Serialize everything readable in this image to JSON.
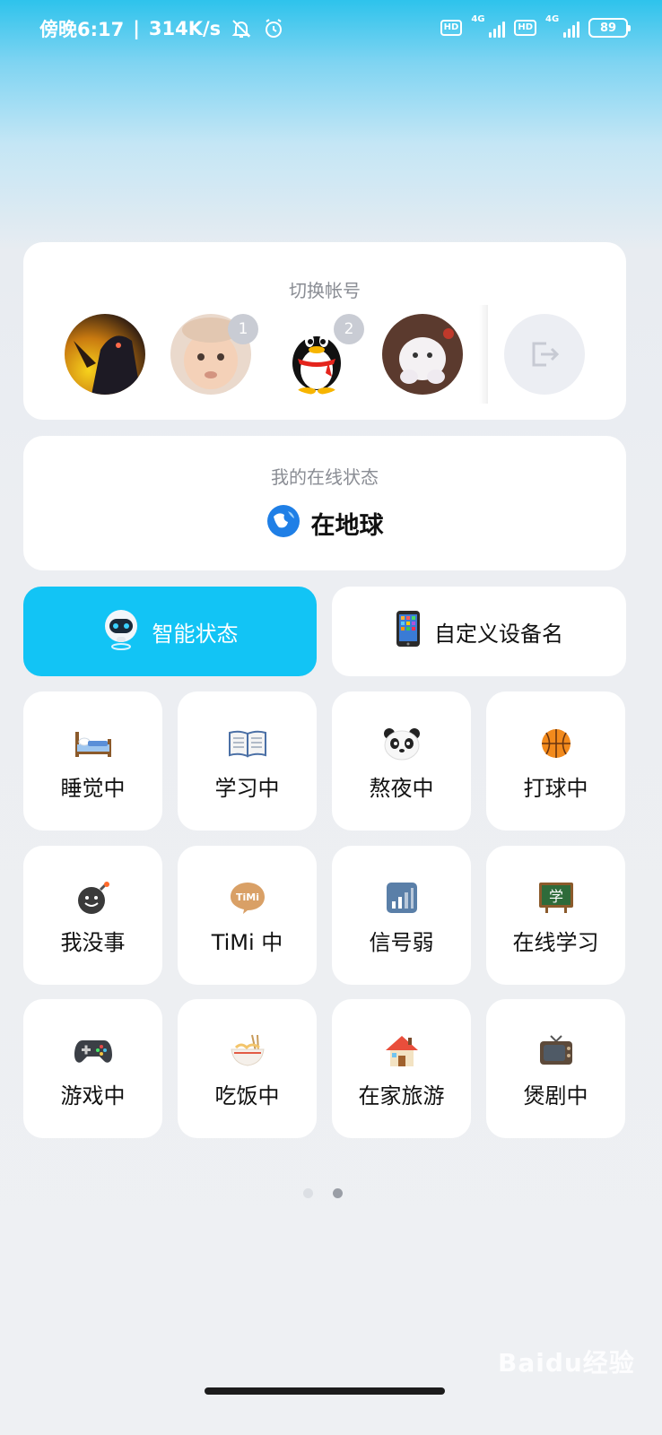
{
  "status_bar": {
    "time": "傍晚6:17",
    "network_speed": "314K/s",
    "icons": [
      "mute-bell-icon",
      "alarm-icon",
      "hd-icon",
      "signal-4g-icon",
      "hd-icon",
      "signal-4g-icon"
    ],
    "hd_label": "HD",
    "network_type": "4G",
    "battery": "89"
  },
  "accounts": {
    "title": "切换帐号",
    "items": [
      {
        "name": "avatar-dark-character",
        "badge": ""
      },
      {
        "name": "avatar-baby",
        "badge": "1"
      },
      {
        "name": "avatar-qq-penguin",
        "badge": "2"
      },
      {
        "name": "avatar-white-fluffy",
        "badge": ""
      }
    ],
    "logout_icon": "logout-icon"
  },
  "online_status": {
    "title": "我的在线状态",
    "value": "在地球",
    "icon": "earth-icon"
  },
  "actions": {
    "smart_label": "智能状态",
    "smart_icon": "robot-icon",
    "device_label": "自定义设备名",
    "device_icon": "phone-icon"
  },
  "statuses": [
    {
      "label": "睡觉中",
      "icon": "bed-icon"
    },
    {
      "label": "学习中",
      "icon": "book-icon"
    },
    {
      "label": "熬夜中",
      "icon": "panda-icon"
    },
    {
      "label": "打球中",
      "icon": "basketball-icon"
    },
    {
      "label": "我没事",
      "icon": "bomb-smile-icon"
    },
    {
      "label": "TiMi 中",
      "icon": "timi-icon"
    },
    {
      "label": "信号弱",
      "icon": "signal-weak-icon"
    },
    {
      "label": "在线学习",
      "icon": "blackboard-icon"
    },
    {
      "label": "游戏中",
      "icon": "gamepad-icon"
    },
    {
      "label": "吃饭中",
      "icon": "noodles-icon"
    },
    {
      "label": "在家旅游",
      "icon": "house-icon"
    },
    {
      "label": "煲剧中",
      "icon": "tv-icon"
    }
  ],
  "emblem_text": {
    "blackboard": "学",
    "timi": "TiMi"
  },
  "pager": {
    "count": 2,
    "active": 2
  },
  "colors": {
    "accent": "#12c4f5",
    "card": "#ffffff",
    "badge": "#c9ccd4"
  },
  "watermark": "Baidu经验"
}
